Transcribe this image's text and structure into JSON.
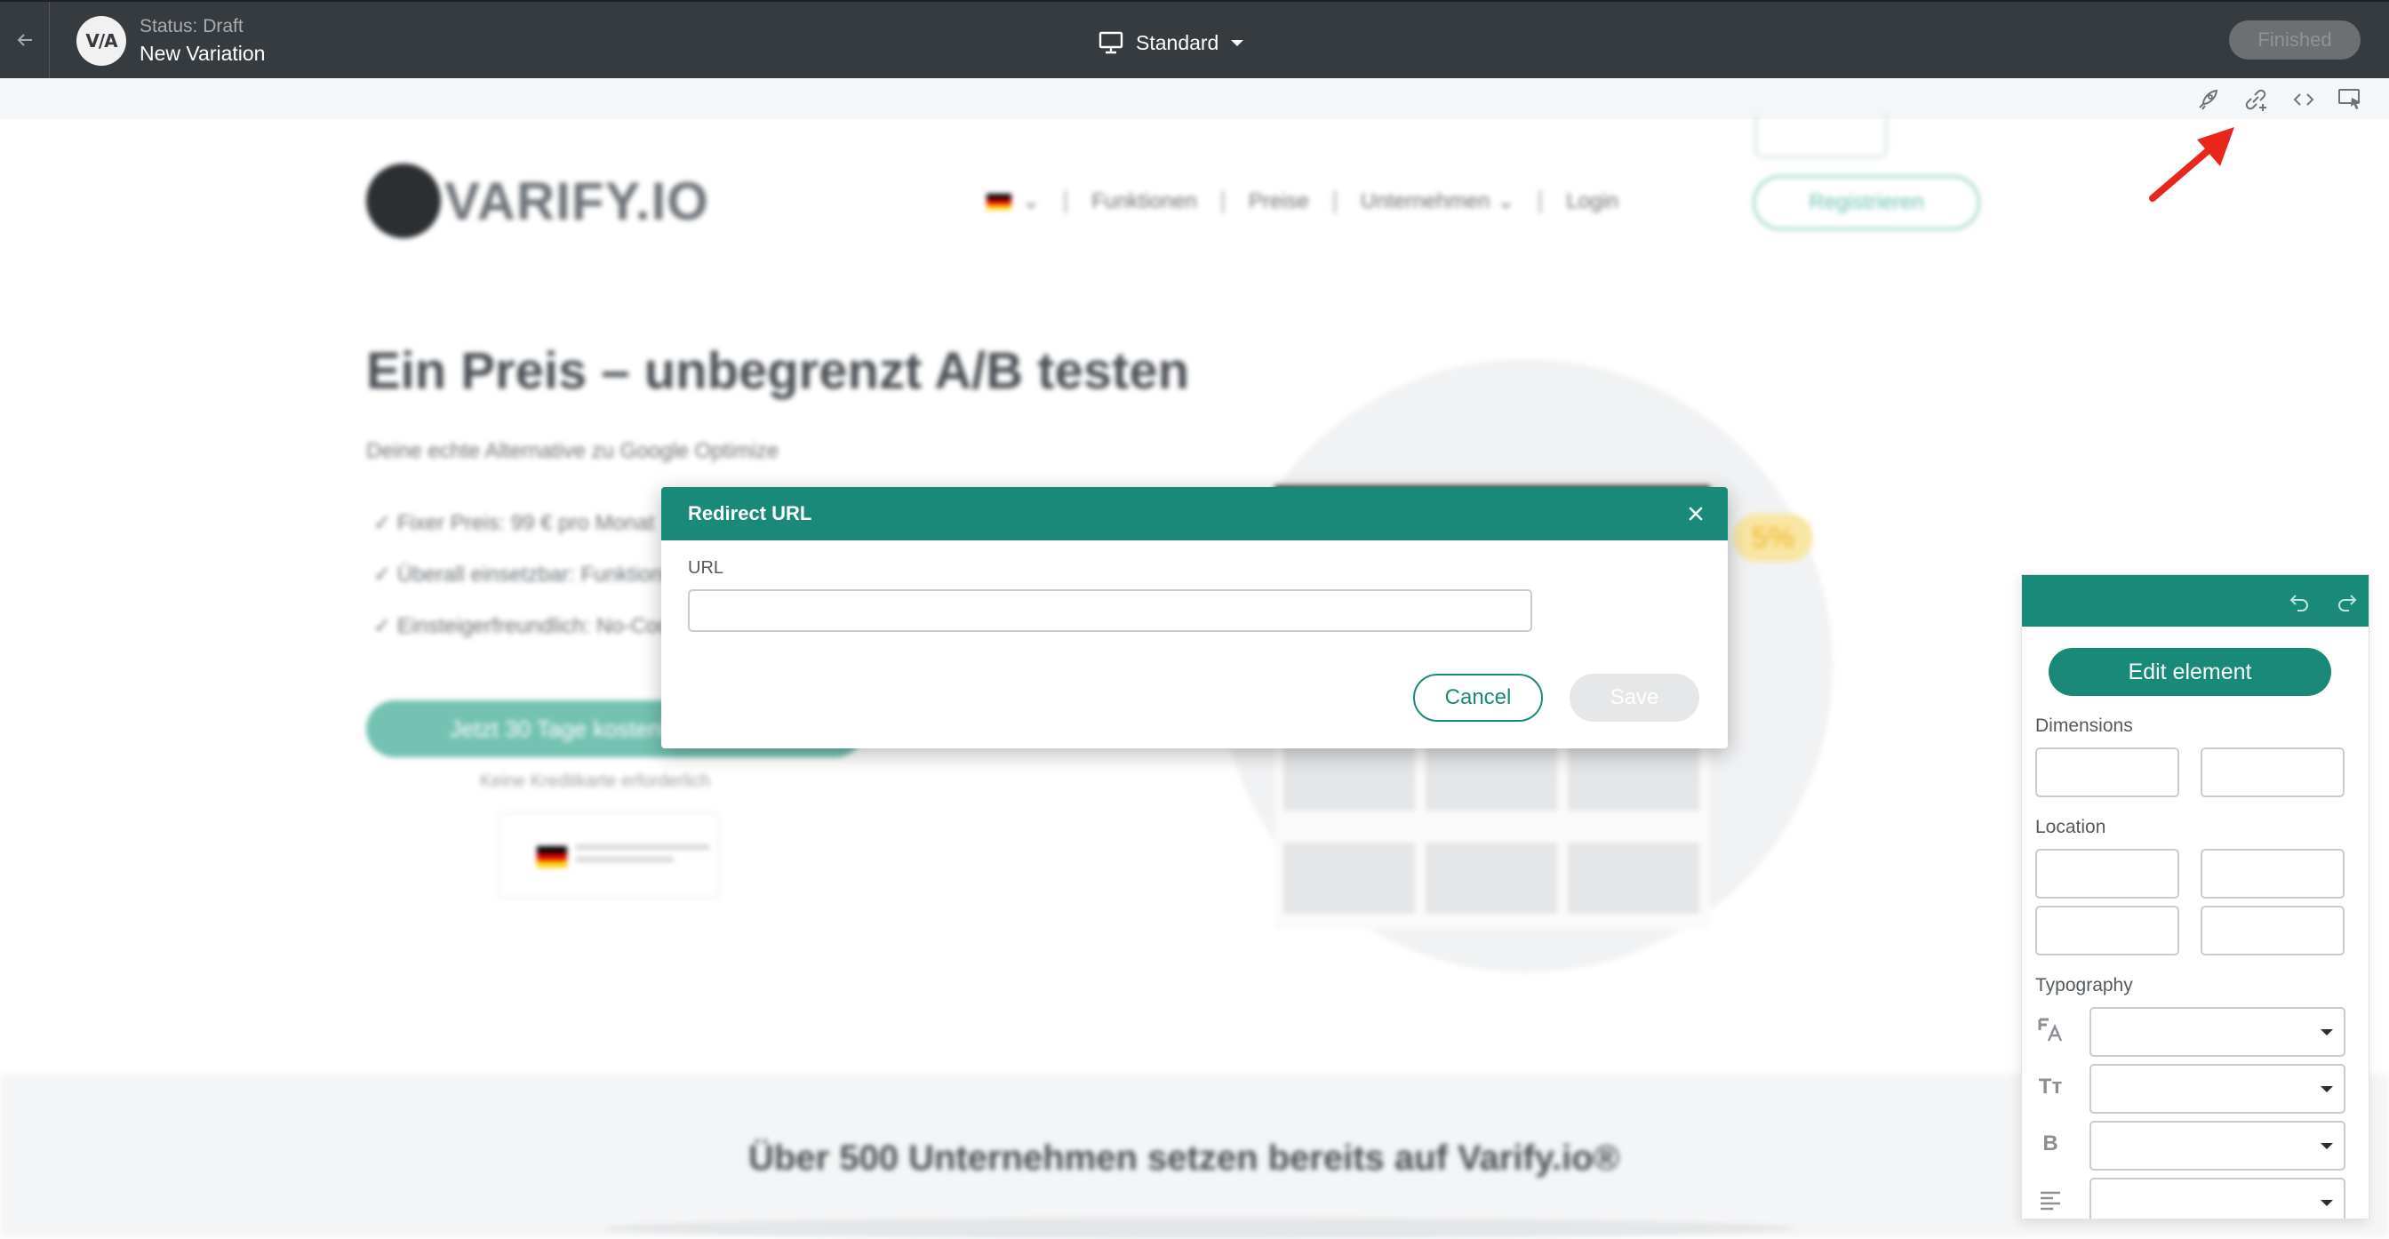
{
  "topbar": {
    "status": "Status: Draft",
    "variation_name": "New Variation",
    "device": "Standard",
    "finished_label": "Finished",
    "logo_text": "V/A"
  },
  "tools": {
    "icons": [
      "rocket-icon",
      "add-link-icon",
      "code-icon",
      "select-element-icon"
    ]
  },
  "website": {
    "logo_text": "VARIFY.IO",
    "nav": [
      "Funktionen",
      "Preise",
      "Unternehmen",
      "Login"
    ],
    "register_label": "Registrieren",
    "headline": "Ein Preis – unbegrenzt A/B testen",
    "subline": "Deine echte Alternative zu Google Optimize",
    "checks": [
      "Fixer Preis: 99 € pro Monat",
      "Überall einsetzbar: Funktioniert",
      "Einsteigerfreundlich: No-Code"
    ],
    "cta_label": "Jetzt 30 Tage kostenlos testen",
    "cta_note": "Keine Kreditkarte erforderlich",
    "badge_percent": "5%",
    "band_text": "Über 500 Unternehmen setzen bereits auf Varify.io®"
  },
  "modal": {
    "title": "Redirect URL",
    "url_label": "URL",
    "url_value": "",
    "url_placeholder": "",
    "cancel_label": "Cancel",
    "save_label": "Save"
  },
  "panel": {
    "edit_label": "Edit element",
    "dimensions_label": "Dimensions",
    "location_label": "Location",
    "typography_label": "Typography",
    "font_family_glyph": "A",
    "font_size_glyph": "Tт",
    "font_weight_glyph": "B"
  },
  "colors": {
    "accent": "#19897a",
    "topbar": "#363b3f",
    "arrow": "#e8261c"
  }
}
